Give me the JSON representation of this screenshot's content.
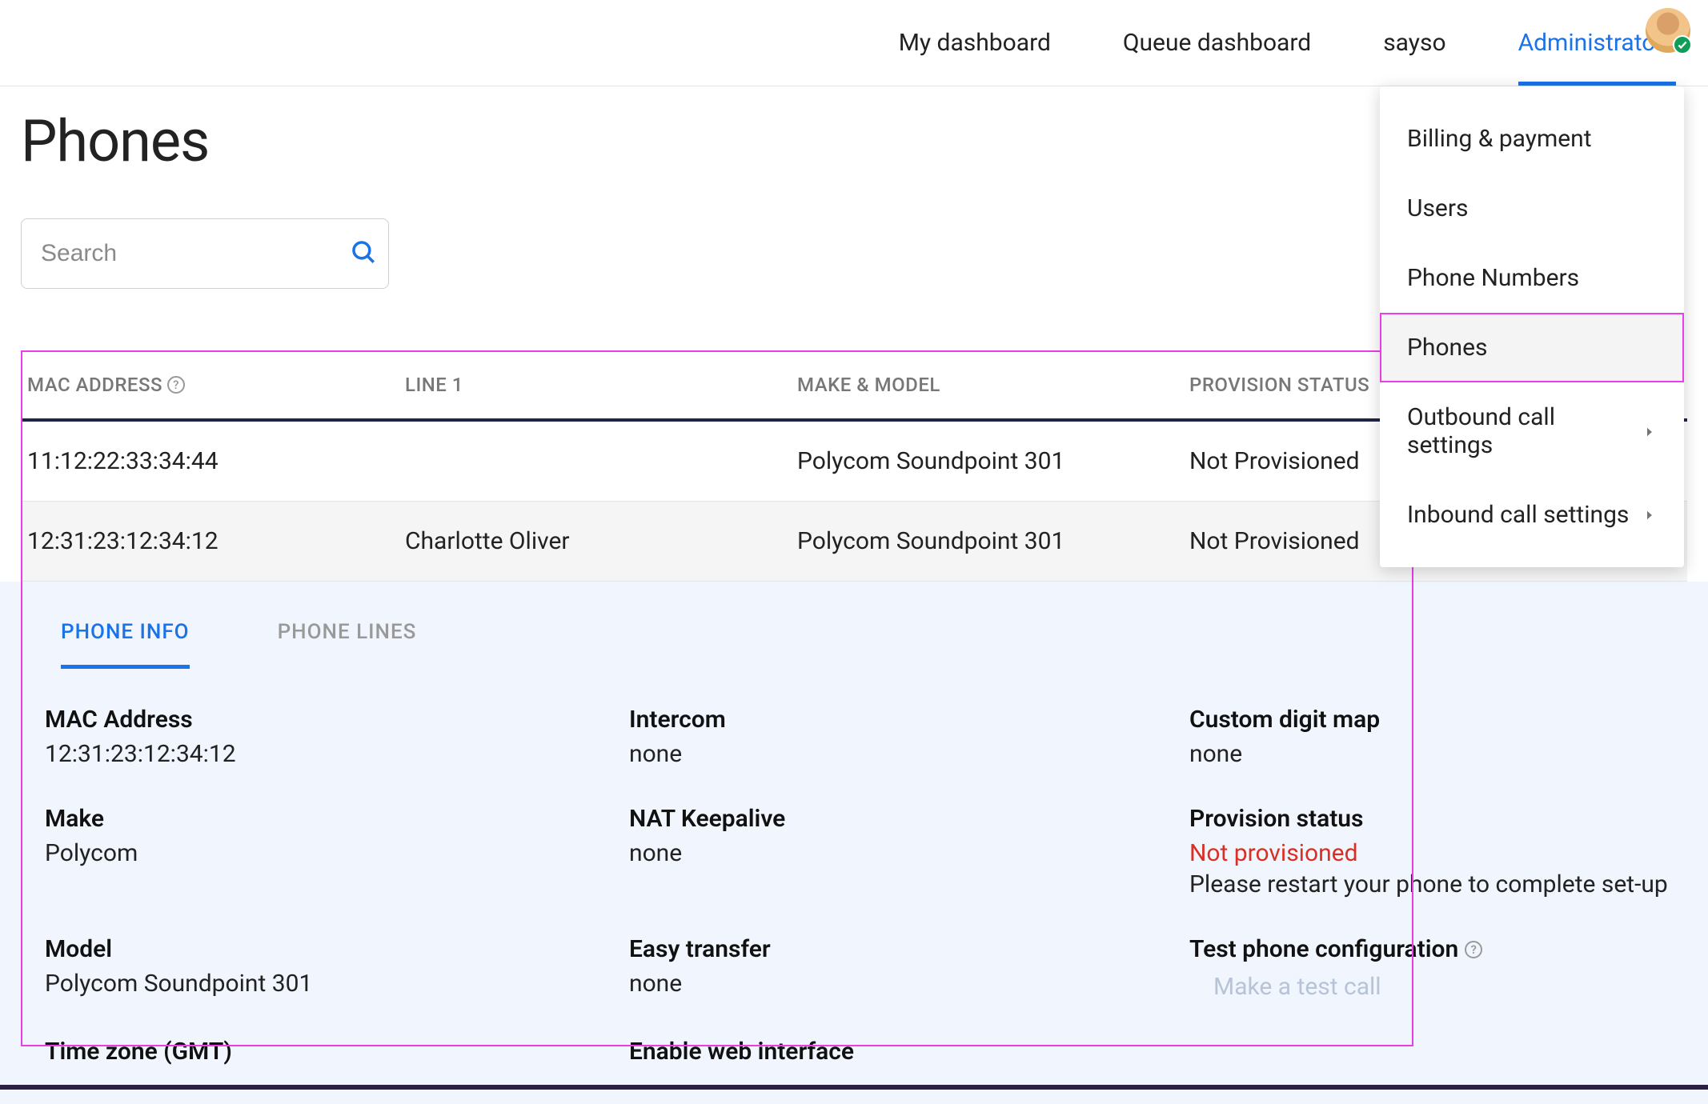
{
  "nav": {
    "items": [
      "My dashboard",
      "Queue dashboard",
      "sayso",
      "Administrators"
    ],
    "active_index": 3
  },
  "dropdown": {
    "items": [
      {
        "label": "Billing & payment",
        "has_sub": false
      },
      {
        "label": "Users",
        "has_sub": false
      },
      {
        "label": "Phone Numbers",
        "has_sub": false
      },
      {
        "label": "Phones",
        "has_sub": false
      },
      {
        "label": "Outbound call settings",
        "has_sub": true
      },
      {
        "label": "Inbound call settings",
        "has_sub": true
      }
    ],
    "selected_index": 3
  },
  "page": {
    "title": "Phones"
  },
  "search": {
    "placeholder": "Search"
  },
  "table": {
    "headers": {
      "mac": "MAC ADDRESS",
      "line1": "LINE 1",
      "make": "MAKE & MODEL",
      "status": "PROVISION STATUS"
    },
    "rows": [
      {
        "mac": "11:12:22:33:34:44",
        "line1": "",
        "make": "Polycom Soundpoint 301",
        "status": "Not Provisioned"
      },
      {
        "mac": "12:31:23:12:34:12",
        "line1": "Charlotte Oliver",
        "make": "Polycom Soundpoint 301",
        "status": "Not Provisioned"
      }
    ],
    "selected_index": 1
  },
  "detail": {
    "tabs": [
      "PHONE INFO",
      "PHONE LINES"
    ],
    "active_tab": 0,
    "fields": {
      "mac_label": "MAC Address",
      "mac_value": "12:31:23:12:34:12",
      "make_label": "Make",
      "make_value": "Polycom",
      "model_label": "Model",
      "model_value": "Polycom Soundpoint 301",
      "timezone_label": "Time zone (GMT)",
      "intercom_label": "Intercom",
      "intercom_value": "none",
      "nat_label": "NAT Keepalive",
      "nat_value": "none",
      "easy_label": "Easy transfer",
      "easy_value": "none",
      "web_label": "Enable web interface",
      "digit_label": "Custom digit map",
      "digit_value": "none",
      "prov_label": "Provision status",
      "prov_value": "Not provisioned",
      "prov_note": "Please restart your phone to complete set-up",
      "test_label": "Test phone configuration",
      "test_link": "Make a test call"
    }
  }
}
